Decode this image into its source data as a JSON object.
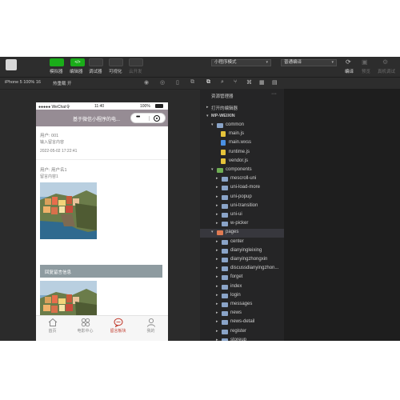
{
  "toolbar": {
    "buttons": [
      {
        "label": "模拟器"
      },
      {
        "label": "编辑器"
      },
      {
        "label": "调试器"
      },
      {
        "label": "可视化"
      },
      {
        "label": "云开发"
      }
    ],
    "compile_badge": "</>",
    "mode_select": "小程序模式",
    "compile_select": "普通编译",
    "right_labels": [
      "编译",
      "预览",
      "真机调试"
    ]
  },
  "simulator": {
    "device": "iPhone 5 100% 16",
    "hot_reload": "热重载 开"
  },
  "phone": {
    "status": {
      "carrier": "●●●●● WeChat令",
      "time": "11:40",
      "battery": "100%"
    },
    "nav_title": "基于微信小程序的电...",
    "posts": [
      {
        "user": "用户: 001",
        "content": "输入留言内容",
        "time": "2022-05-02 17:22:41"
      },
      {
        "user": "用户: 用户名1",
        "content": "留言内容1"
      }
    ],
    "reply_label": "回复留言信息",
    "tabs": [
      {
        "label": "首页",
        "icon": "home-icon"
      },
      {
        "label": "电影中心",
        "icon": "grid-icon"
      },
      {
        "label": "留言板块",
        "icon": "chat-icon"
      },
      {
        "label": "我的",
        "icon": "user-icon"
      }
    ]
  },
  "explorer": {
    "header": "资源管理器",
    "open_editors": "打开的编辑器",
    "project": "MP-WEIXIN",
    "tree": [
      {
        "name": "common",
        "type": "folder",
        "expanded": true,
        "depth": 1
      },
      {
        "name": "main.js",
        "type": "js",
        "depth": 2
      },
      {
        "name": "main.wxss",
        "type": "wxss",
        "depth": 2
      },
      {
        "name": "runtime.js",
        "type": "js",
        "depth": 2
      },
      {
        "name": "vendor.js",
        "type": "js",
        "depth": 2
      },
      {
        "name": "components",
        "type": "folder-green",
        "expanded": true,
        "depth": 1
      },
      {
        "name": "mescroll-uni",
        "type": "folder",
        "depth": 2
      },
      {
        "name": "uni-load-more",
        "type": "folder",
        "depth": 2
      },
      {
        "name": "uni-popup",
        "type": "folder",
        "depth": 2
      },
      {
        "name": "uni-transition",
        "type": "folder",
        "depth": 2
      },
      {
        "name": "uni-ui",
        "type": "folder",
        "depth": 2
      },
      {
        "name": "w-picker",
        "type": "folder",
        "depth": 2
      },
      {
        "name": "pages",
        "type": "folder-orange",
        "expanded": true,
        "depth": 1,
        "selected": true
      },
      {
        "name": "center",
        "type": "folder",
        "depth": 2
      },
      {
        "name": "dianyingleixing",
        "type": "folder",
        "depth": 2
      },
      {
        "name": "dianyingzhongxin",
        "type": "folder",
        "depth": 2
      },
      {
        "name": "discussdianyingzhon...",
        "type": "folder",
        "depth": 2
      },
      {
        "name": "forget",
        "type": "folder",
        "depth": 2
      },
      {
        "name": "index",
        "type": "folder",
        "depth": 2
      },
      {
        "name": "login",
        "type": "folder",
        "depth": 2
      },
      {
        "name": "messages",
        "type": "folder",
        "depth": 2
      },
      {
        "name": "news",
        "type": "folder",
        "depth": 2
      },
      {
        "name": "news-detail",
        "type": "folder",
        "depth": 2
      },
      {
        "name": "register",
        "type": "folder",
        "depth": 2
      },
      {
        "name": "storeup",
        "type": "folder",
        "depth": 2
      }
    ]
  }
}
